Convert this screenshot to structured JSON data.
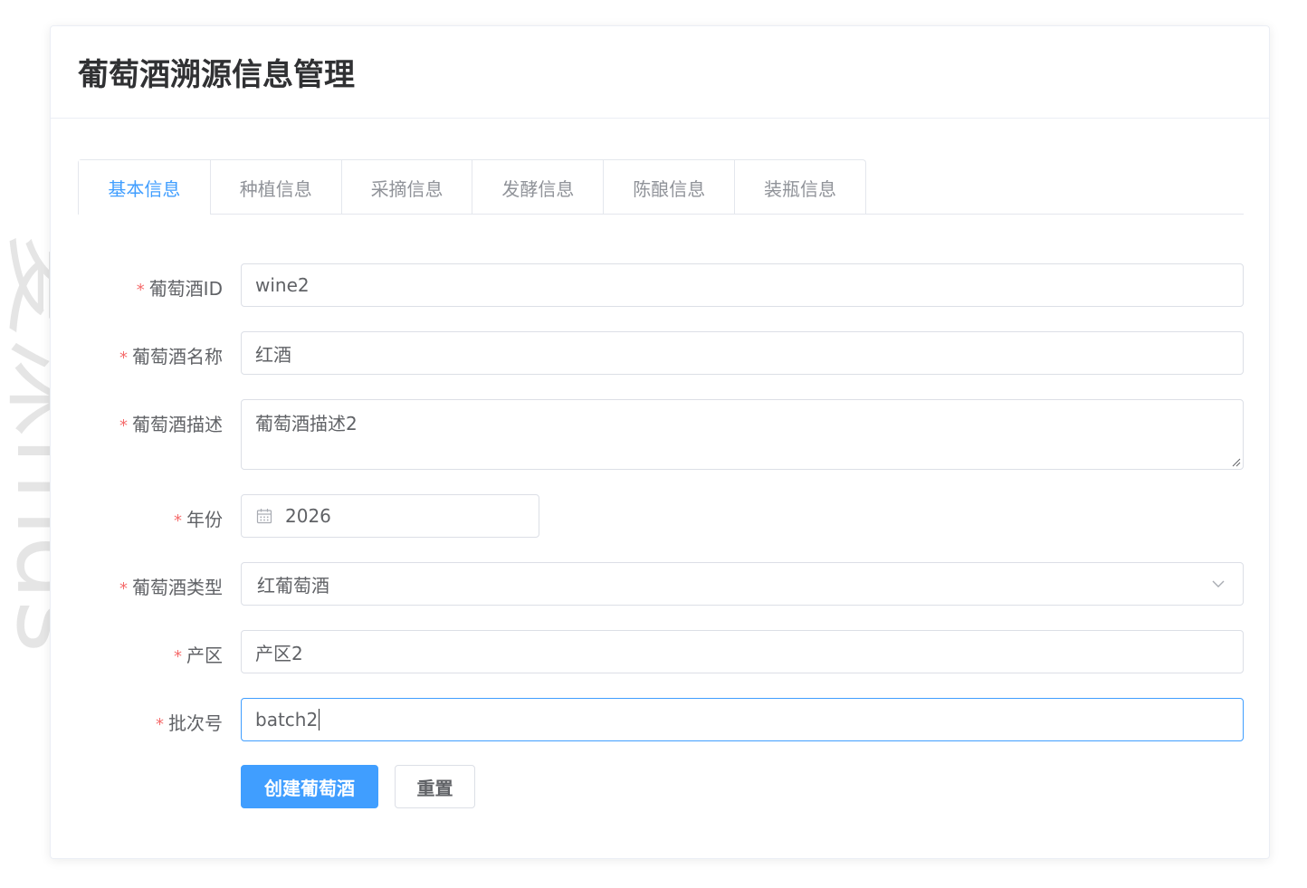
{
  "header": {
    "title": "葡萄酒溯源信息管理"
  },
  "tabs": [
    {
      "label": "基本信息",
      "active": true
    },
    {
      "label": "种植信息",
      "active": false
    },
    {
      "label": "采摘信息",
      "active": false
    },
    {
      "label": "发酵信息",
      "active": false
    },
    {
      "label": "陈酿信息",
      "active": false
    },
    {
      "label": "装瓶信息",
      "active": false
    }
  ],
  "form": {
    "wine_id": {
      "label": "葡萄酒ID",
      "value": "wine2",
      "required": true
    },
    "wine_name": {
      "label": "葡萄酒名称",
      "value": "红酒",
      "required": true
    },
    "wine_desc": {
      "label": "葡萄酒描述",
      "value": "葡萄酒描述2",
      "required": true
    },
    "year": {
      "label": "年份",
      "value": "2026",
      "required": true
    },
    "wine_type": {
      "label": "葡萄酒类型",
      "value": "红葡萄酒",
      "required": true
    },
    "region": {
      "label": "产区",
      "value": "产区2",
      "required": true
    },
    "batch_no": {
      "label": "批次号",
      "value": "batch2",
      "required": true
    }
  },
  "required_mark": "*",
  "buttons": {
    "create": "创建葡萄酒",
    "reset": "重置"
  },
  "watermark": {
    "text": "夏沫mds"
  },
  "colors": {
    "primary": "#409eff",
    "required": "#f56c6c",
    "border": "#dcdfe6",
    "title": "#303133",
    "tab_inactive": "#909399"
  },
  "icons": {
    "date": "calendar-icon",
    "select": "chevron-down-icon",
    "textarea_resize": "resize-handle-icon"
  }
}
